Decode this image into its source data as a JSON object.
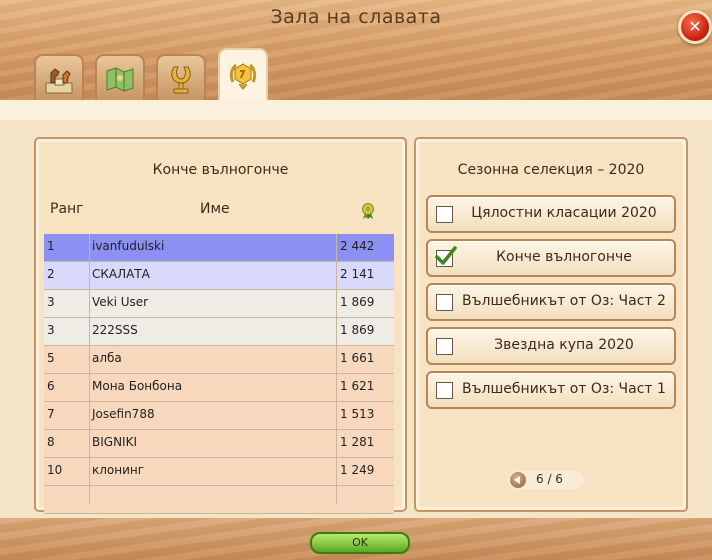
{
  "window": {
    "title": "Зала на славата",
    "close_label": "✕"
  },
  "tabs": [
    {
      "icon": "horse-podium-icon"
    },
    {
      "icon": "map-icon"
    },
    {
      "icon": "horseshoe-trophy-icon"
    },
    {
      "icon": "laurel-medal-icon",
      "active": true
    }
  ],
  "leaderboard": {
    "title": "Конче вълногонче",
    "col_rank": "Ранг",
    "col_name": "Име",
    "col_score_icon": "medal-icon",
    "rows": [
      {
        "rank": "1",
        "name": "ivanfudulski",
        "score": "2 442"
      },
      {
        "rank": "2",
        "name": "СКАЛАТА",
        "score": "2 141"
      },
      {
        "rank": "3",
        "name": "Veki User",
        "score": "1 869"
      },
      {
        "rank": "3",
        "name": "222SSS",
        "score": "1 869"
      },
      {
        "rank": "5",
        "name": "алба",
        "score": "1 661"
      },
      {
        "rank": "6",
        "name": "Мона Бонбона",
        "score": "1 621"
      },
      {
        "rank": "7",
        "name": "Josefin788",
        "score": "1 513"
      },
      {
        "rank": "8",
        "name": "BIGNIKI",
        "score": "1 281"
      },
      {
        "rank": "10",
        "name": "клонинг",
        "score": "1 249"
      },
      {
        "rank": "",
        "name": "",
        "score": ""
      }
    ],
    "row_colors": [
      "#8c90f2",
      "#d8d8fb",
      "#efece6",
      "#efece6",
      "#f7d8bc",
      "#f7d8bc",
      "#f7d8bc",
      "#f7d8bc",
      "#f7d8bc",
      "#f7d8bc"
    ]
  },
  "selection": {
    "title": "Сезонна селекция – 2020",
    "items": [
      {
        "label": "Цялостни класации 2020",
        "checked": false
      },
      {
        "label": "Конче вълногонче",
        "checked": true
      },
      {
        "label": "Вълшебникът от Оз: Част 2",
        "checked": false
      },
      {
        "label": "Звездна купа 2020",
        "checked": false
      },
      {
        "label": "Вълшебникът от Оз: Част 1",
        "checked": false
      }
    ],
    "pager": "6 / 6"
  },
  "footer": {
    "ok_label": "OK"
  }
}
